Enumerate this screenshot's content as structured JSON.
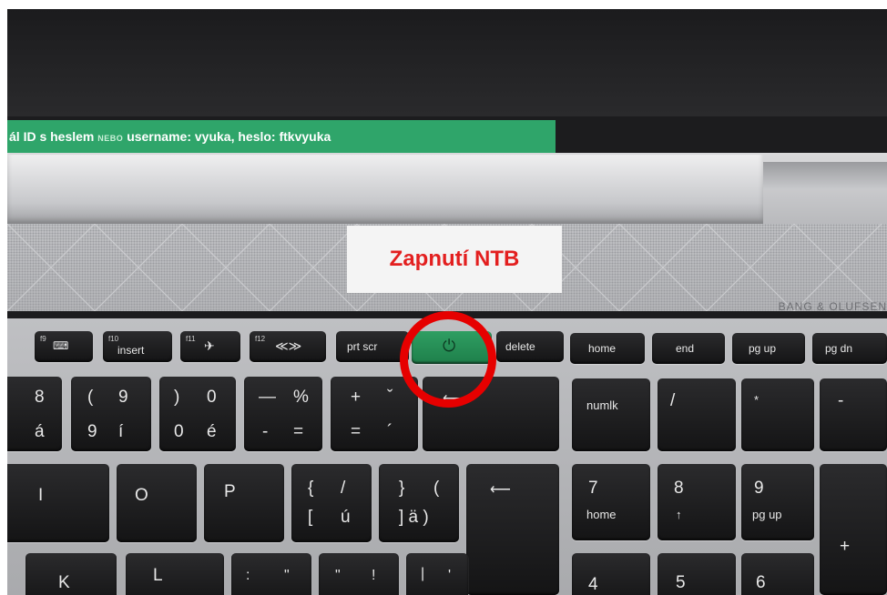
{
  "screen_strip": {
    "part1": "ál ID s heslem",
    "nebo": "NEBO",
    "part2": "username: vyuka, heslo: ftkvyuka"
  },
  "annotation_label": "Zapnutí NTB",
  "brand": "BANG & OLUFSEN",
  "function_row": {
    "f9": "f9",
    "f10": "f10",
    "f10_label": "insert",
    "f11": "f11",
    "f12": "f12",
    "prt_scr": "prt scr",
    "delete": "delete",
    "home": "home",
    "end": "end",
    "pg_up": "pg up",
    "pg_dn": "pg dn"
  },
  "number_row": {
    "k8_top": "8",
    "k8_bottom": "á",
    "k9_top_l": "(",
    "k9_top_r": "9",
    "k9_bottom_l": "9",
    "k9_bottom_r": "í",
    "k0_top_l": ")",
    "k0_top_r": "0",
    "k0_bottom_l": "0",
    "k0_bottom_r": "é",
    "minus_top_l": "—",
    "minus_top_r": "%",
    "minus_bottom_l": "-",
    "minus_bottom_r": "=",
    "plus_top_l": "+",
    "plus_top_r": "ˇ",
    "plus_bottom_l": "=",
    "plus_bottom_r": "´",
    "numlk": "numlk",
    "slash": "/",
    "star": "*",
    "minus": "-"
  },
  "letter_row": {
    "i": "I",
    "o": "O",
    "p": "P",
    "bracket_l_top_l": "{",
    "bracket_l_top_r": "/",
    "bracket_l_bottom_l": "[",
    "bracket_l_bottom_r": "ú",
    "bracket_r_top_l": "}",
    "bracket_r_top_r": "(",
    "bracket_r_bottom": "] ä )",
    "enter": "⟵",
    "num7": "7",
    "num7_sub": "home",
    "num8": "8",
    "num8_sub": "↑",
    "num9": "9",
    "num9_sub": "pg up",
    "plus": "+"
  },
  "bottom_row": {
    "k": "K",
    "l": "L",
    "colon_l": ":",
    "colon_r": "\"",
    "quote_l": "\"",
    "quote_r": "!",
    "pipe_l": "|",
    "pipe_r": "'",
    "num4": "4",
    "num5": "5",
    "num6": "6"
  },
  "colors": {
    "annotation": "#e31f1f",
    "highlight_ring": "#e60000",
    "power_key": "#2f9e62",
    "screen_strip": "#2fa56a"
  }
}
